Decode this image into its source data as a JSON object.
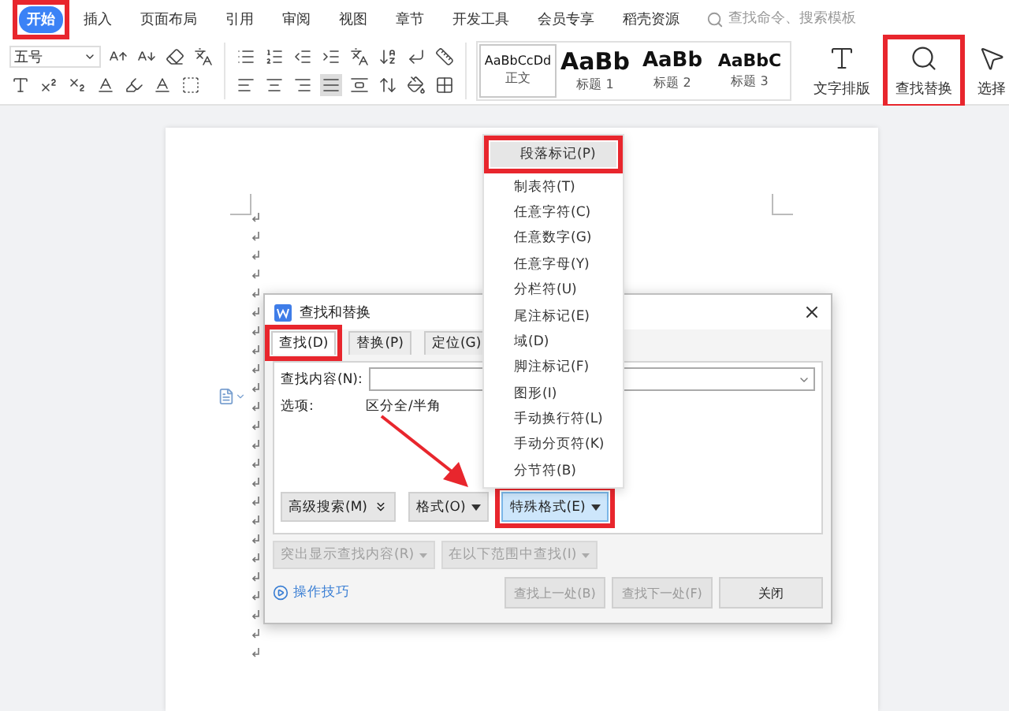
{
  "ribbon_tabs": [
    {
      "label": "开始",
      "selected": true,
      "annotated": true
    },
    {
      "label": "插入",
      "selected": false,
      "annotated": false
    },
    {
      "label": "页面布局",
      "selected": false,
      "annotated": false
    },
    {
      "label": "引用",
      "selected": false,
      "annotated": false
    },
    {
      "label": "审阅",
      "selected": false,
      "annotated": false
    },
    {
      "label": "视图",
      "selected": false,
      "annotated": false
    },
    {
      "label": "章节",
      "selected": false,
      "annotated": false
    },
    {
      "label": "开发工具",
      "selected": false,
      "annotated": false
    },
    {
      "label": "会员专享",
      "selected": false,
      "annotated": false
    },
    {
      "label": "稻壳资源",
      "selected": false,
      "annotated": false
    }
  ],
  "command_search": {
    "placeholder": "查找命令、搜索模板"
  },
  "font_size": {
    "value": "五号"
  },
  "styles": [
    {
      "sample": "AaBbCcDd",
      "label": "正文",
      "kind": "body",
      "selected": true
    },
    {
      "sample": "AaBb",
      "label": "标题 1",
      "kind": "heading1",
      "selected": false
    },
    {
      "sample": "AaBb",
      "label": "标题 2",
      "kind": "heading2",
      "selected": false
    },
    {
      "sample": "AaBbC",
      "label": "标题 3",
      "kind": "heading3",
      "selected": false
    }
  ],
  "large_commands": [
    {
      "label": "文字排版",
      "kind": "layout",
      "annotated": false
    },
    {
      "label": "查找替换",
      "kind": "find",
      "annotated": true
    },
    {
      "label": "选择",
      "kind": "select",
      "annotated": false
    }
  ],
  "special_menu": {
    "items": [
      {
        "label": "段落标记(P)",
        "selected": true,
        "annotated": true
      },
      {
        "label": "制表符(T)",
        "selected": false,
        "annotated": false
      },
      {
        "label": "任意字符(C)",
        "selected": false,
        "annotated": false
      },
      {
        "label": "任意数字(G)",
        "selected": false,
        "annotated": false
      },
      {
        "label": "任意字母(Y)",
        "selected": false,
        "annotated": false
      },
      {
        "label": "分栏符(U)",
        "selected": false,
        "annotated": false
      },
      {
        "label": "尾注标记(E)",
        "selected": false,
        "annotated": false
      },
      {
        "label": "域(D)",
        "selected": false,
        "annotated": false
      },
      {
        "label": "脚注标记(F)",
        "selected": false,
        "annotated": false
      },
      {
        "label": "图形(I)",
        "selected": false,
        "annotated": false
      },
      {
        "label": "手动换行符(L)",
        "selected": false,
        "annotated": false
      },
      {
        "label": "手动分页符(K)",
        "selected": false,
        "annotated": false
      },
      {
        "label": "分节符(B)",
        "selected": false,
        "annotated": false
      }
    ]
  },
  "dialog": {
    "title": "查找和替换",
    "tabs": [
      {
        "label": "查找(D)",
        "selected": true,
        "annotated": true
      },
      {
        "label": "替换(P)",
        "selected": false,
        "annotated": false
      },
      {
        "label": "定位(G)",
        "selected": false,
        "annotated": false
      }
    ],
    "find_label": "查找内容(N):",
    "options_label": "选项:",
    "options_value": "区分全/半角",
    "buttons": [
      {
        "label": "高级搜索(M)",
        "kind": "expand",
        "selected": false,
        "annotated": false
      },
      {
        "label": "格式(O)",
        "kind": "dropdown",
        "selected": false,
        "annotated": false
      },
      {
        "label": "特殊格式(E)",
        "kind": "dropdown",
        "selected": true,
        "annotated": true
      }
    ],
    "scope_buttons": [
      {
        "label": "突出显示查找内容(R)",
        "disabled": true
      },
      {
        "label": "在以下范围中查找(I)",
        "disabled": true
      }
    ],
    "tips_link": "操作技巧",
    "footer_buttons": [
      {
        "label": "查找上一处(B)",
        "disabled": true
      },
      {
        "label": "查找下一处(F)",
        "disabled": true
      },
      {
        "label": "关闭",
        "disabled": false
      }
    ]
  }
}
